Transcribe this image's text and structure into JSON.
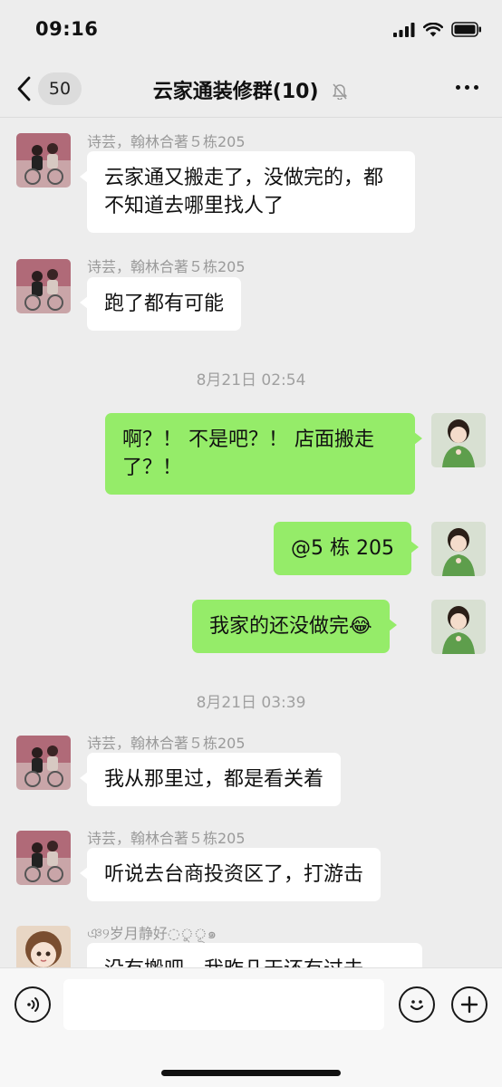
{
  "status": {
    "time": "09:16"
  },
  "nav": {
    "back_count": "50",
    "title": "云家通装修群(10)"
  },
  "messages": [
    {
      "sender": "诗芸，翰林合著５栋205",
      "text": "云家通又搬走了，没做完的，都不知道去哪里找人了"
    },
    {
      "sender": "诗芸，翰林合著５栋205",
      "text": "跑了都有可能"
    },
    {
      "timestamp": "8月21日 02:54"
    },
    {
      "text": "啊？！ 不是吧？！ 店面搬走了？！"
    },
    {
      "text": "@5 栋 205"
    },
    {
      "text": "我家的还没做完😂"
    },
    {
      "timestamp": "8月21日 03:39"
    },
    {
      "sender": "诗芸，翰林合著５栋205",
      "text": "我从那里过，都是看关着"
    },
    {
      "sender": "诗芸，翰林合著５栋205",
      "text": "听说去台商投资区了，打游击"
    },
    {
      "sender": "ঞ୨岁月静好◌ু◌ূ๑",
      "text": "没有搬吧，我昨几天还有过去"
    }
  ],
  "input": {
    "placeholder": ""
  },
  "icons": {
    "back": "chevron-left-icon",
    "mute": "bell-off-icon",
    "more": "more-dots-icon",
    "voice": "voice-icon",
    "emoji": "emoji-icon",
    "plus": "plus-icon"
  },
  "colors": {
    "outgoing_bubble": "#95ec69",
    "incoming_bubble": "#ffffff",
    "background": "#ededed"
  }
}
